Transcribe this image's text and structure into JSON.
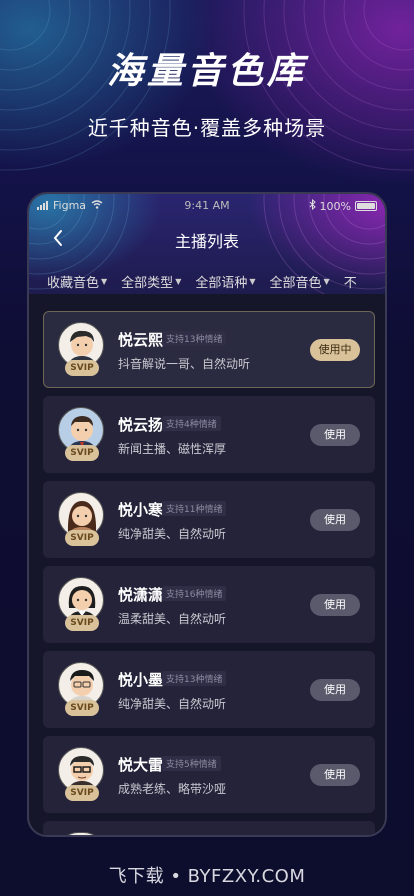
{
  "hero": {
    "title": "海量音色库",
    "subtitle": "近千种音色·覆盖多种场景"
  },
  "statusbar": {
    "carrier": "Figma",
    "time": "9:41 AM",
    "battery": "100%",
    "battery_level": 1.0
  },
  "navbar": {
    "back_icon": "‹",
    "title": "主播列表"
  },
  "filters": [
    "收藏音色",
    "全部类型",
    "全部语种",
    "全部音色",
    "不"
  ],
  "badge": "SVIP",
  "voices": [
    {
      "name": "悦云熙",
      "tag": "支持13种情绪",
      "desc": "抖音解说一哥、自然动听",
      "button": "使用中",
      "active": true
    },
    {
      "name": "悦云扬",
      "tag": "支持4种情绪",
      "desc": "新闻主播、磁性浑厚",
      "button": "使用",
      "active": false
    },
    {
      "name": "悦小寒",
      "tag": "支持11种情绪",
      "desc": "纯净甜美、自然动听",
      "button": "使用",
      "active": false
    },
    {
      "name": "悦潇潇",
      "tag": "支持16种情绪",
      "desc": "温柔甜美、自然动听",
      "button": "使用",
      "active": false
    },
    {
      "name": "悦小墨",
      "tag": "支持13种情绪",
      "desc": "纯净甜美、自然动听",
      "button": "使用",
      "active": false
    },
    {
      "name": "悦大雷",
      "tag": "支持5种情绪",
      "desc": "成熟老练、略带沙哑",
      "button": "使用",
      "active": false
    }
  ],
  "footer": "飞下载 • BYFZXY.COM",
  "colors": {
    "accent_gold": "#d9c29a",
    "card_bg": "#24233a",
    "button_gray": "#5b5a6c"
  }
}
